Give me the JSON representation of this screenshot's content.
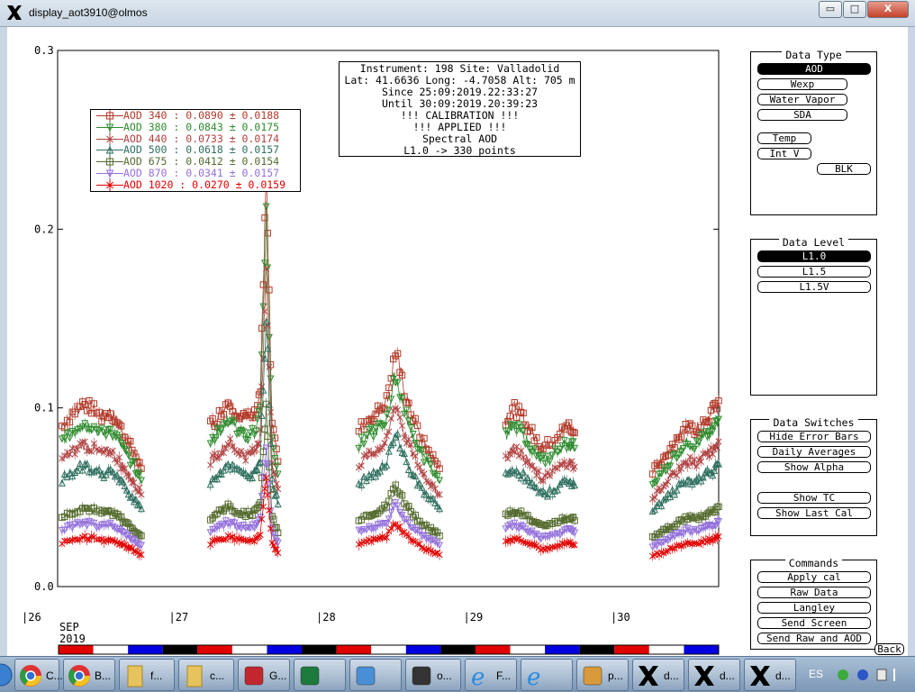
{
  "window": {
    "title": "display_aot3910@olmos",
    "min_glyph": "▭",
    "max_glyph": "□",
    "close_glyph": "X"
  },
  "colors": {
    "aod340": "#b23a2a",
    "aod380": "#2e8b2e",
    "aod440": "#b04040",
    "aod500": "#2f6f5f",
    "aod675": "#556b2f",
    "aod870": "#9370db",
    "aod1020": "#e00000"
  },
  "info_box": {
    "lines": [
      "Instrument: 198 Site: Valladolid",
      "Lat: 41.6636 Long: -4.7058 Alt: 705 m",
      "Since 25:09:2019.22:33:27",
      "Until 30:09:2019.20:39:23",
      "!!! CALIBRATION !!!",
      "!!!   APPLIED   !!!",
      "Spectral AOD",
      "L1.0 -> 330 points"
    ]
  },
  "legend": [
    {
      "text": "AOD 340   : 0.0890 ± 0.0188",
      "color": "#b23a2a",
      "marker": "square"
    },
    {
      "text": "AOD 380   : 0.0843 ± 0.0175",
      "color": "#2e8b2e",
      "marker": "triangle-down"
    },
    {
      "text": "AOD 440   : 0.0733 ± 0.0174",
      "color": "#b04040",
      "marker": "x"
    },
    {
      "text": "AOD 500   : 0.0618 ± 0.0157",
      "color": "#2f6f5f",
      "marker": "triangle-up"
    },
    {
      "text": "AOD 675   : 0.0412 ± 0.0154",
      "color": "#556b2f",
      "marker": "square"
    },
    {
      "text": "AOD 870   : 0.0341 ± 0.0157",
      "color": "#9370db",
      "marker": "triangle-down"
    },
    {
      "text": "AOD 1020  : 0.0270 ± 0.0159",
      "color": "#e00000",
      "marker": "x"
    }
  ],
  "chart_data": {
    "type": "scatter",
    "ylim": [
      0.0,
      0.3
    ],
    "y_ticks": [
      "0.0",
      "0.1",
      "0.2",
      "0.3"
    ],
    "y_tick_values": [
      0.0,
      0.1,
      0.2,
      0.3
    ],
    "xlim": [
      26.2,
      30.7
    ],
    "day_ticks": [
      {
        "label": "|26",
        "value": 26
      },
      {
        "label": "|27",
        "value": 27
      },
      {
        "label": "|28",
        "value": 28
      },
      {
        "label": "|29",
        "value": 29
      },
      {
        "label": "|30",
        "value": 30
      }
    ],
    "month_label": "SEP",
    "year_label": "2019",
    "day_bar_colors": [
      "#e00000",
      "#ffffff",
      "#0000e0",
      "#000000",
      "#e00000",
      "#ffffff",
      "#0000e0",
      "#000000",
      "#e00000",
      "#ffffff",
      "#0000e0",
      "#000000",
      "#e00000",
      "#ffffff",
      "#0000e0",
      "#000000",
      "#e00000",
      "#ffffff",
      "#0000e0"
    ],
    "segments": [
      {
        "x": [
          26.23,
          26.3,
          26.37,
          26.43,
          26.5,
          26.56,
          26.62,
          26.67,
          26.72,
          26.77
        ],
        "base": [
          0.09,
          0.097,
          0.102,
          0.1,
          0.095,
          0.098,
          0.09,
          0.082,
          0.075,
          0.066
        ]
      },
      {
        "x": [
          27.24,
          27.3,
          27.36,
          27.42,
          27.48,
          27.54,
          27.58,
          27.62,
          27.66,
          27.7
        ],
        "base": [
          0.09,
          0.096,
          0.104,
          0.098,
          0.094,
          0.096,
          0.11,
          0.23,
          0.09,
          0.07
        ]
      },
      {
        "x": [
          28.25,
          28.32,
          28.38,
          28.44,
          28.5,
          28.56,
          28.62,
          28.68,
          28.74,
          28.8
        ],
        "base": [
          0.088,
          0.094,
          0.098,
          0.104,
          0.132,
          0.11,
          0.094,
          0.082,
          0.074,
          0.066
        ]
      },
      {
        "x": [
          29.25,
          29.31,
          29.37,
          29.43,
          29.49,
          29.55,
          29.62,
          29.68,
          29.72
        ],
        "base": [
          0.094,
          0.1,
          0.094,
          0.086,
          0.078,
          0.08,
          0.086,
          0.09,
          0.086
        ]
      },
      {
        "x": [
          30.25,
          30.31,
          30.37,
          30.43,
          30.49,
          30.55,
          30.61,
          30.66,
          30.7
        ],
        "base": [
          0.064,
          0.07,
          0.078,
          0.084,
          0.09,
          0.088,
          0.094,
          0.098,
          0.104
        ]
      }
    ],
    "series": [
      {
        "id": "aod340",
        "ratio": 1.0,
        "color": "#b23a2a",
        "marker": "square"
      },
      {
        "id": "aod380",
        "ratio": 0.9,
        "color": "#2e8b2e",
        "marker": "triangle-down"
      },
      {
        "id": "aod440",
        "ratio": 0.78,
        "color": "#b04040",
        "marker": "x"
      },
      {
        "id": "aod500",
        "ratio": 0.66,
        "color": "#2f6f5f",
        "marker": "triangle-up"
      },
      {
        "id": "aod675",
        "ratio": 0.43,
        "color": "#556b2f",
        "marker": "square"
      },
      {
        "id": "aod870",
        "ratio": 0.35,
        "color": "#9370db",
        "marker": "triangle-down"
      },
      {
        "id": "aod1020",
        "ratio": 0.27,
        "color": "#e00000",
        "marker": "x"
      }
    ]
  },
  "panels": {
    "data_type": {
      "title": "Data Type",
      "buttons": [
        "AOD",
        "Wexp",
        "Water Vapor",
        "SDA",
        "Temp",
        "Int V",
        "BLK"
      ]
    },
    "data_level": {
      "title": "Data Level",
      "buttons": [
        "L1.0",
        "L1.5",
        "L1.5V"
      ]
    },
    "data_switches": {
      "title": "Data Switches",
      "buttons": [
        "Hide Error Bars",
        "Daily Averages",
        "Show Alpha",
        "Show TC",
        "Show Last Cal"
      ]
    },
    "commands": {
      "title": "Commands",
      "buttons": [
        "Apply cal",
        "Raw Data",
        "Langley",
        "Send Screen",
        "Send Raw and AOD"
      ]
    },
    "back": "Back"
  },
  "taskbar": {
    "items": [
      {
        "name": "chrome-1",
        "label": "C..."
      },
      {
        "name": "chrome-2",
        "label": "B..."
      },
      {
        "name": "folder-1",
        "label": "f..."
      },
      {
        "name": "folder-2",
        "label": "c..."
      },
      {
        "name": "pdf",
        "label": "G..."
      },
      {
        "name": "excel",
        "label": ""
      },
      {
        "name": "network",
        "label": ""
      },
      {
        "name": "terminal",
        "label": "o..."
      },
      {
        "name": "ie-1",
        "label": "F..."
      },
      {
        "name": "ie-2",
        "label": ""
      },
      {
        "name": "paint",
        "label": "p..."
      },
      {
        "name": "x-1",
        "label": "d..."
      },
      {
        "name": "x-2",
        "label": "d..."
      },
      {
        "name": "x-3",
        "label": "d..."
      }
    ],
    "lang": "ES"
  }
}
